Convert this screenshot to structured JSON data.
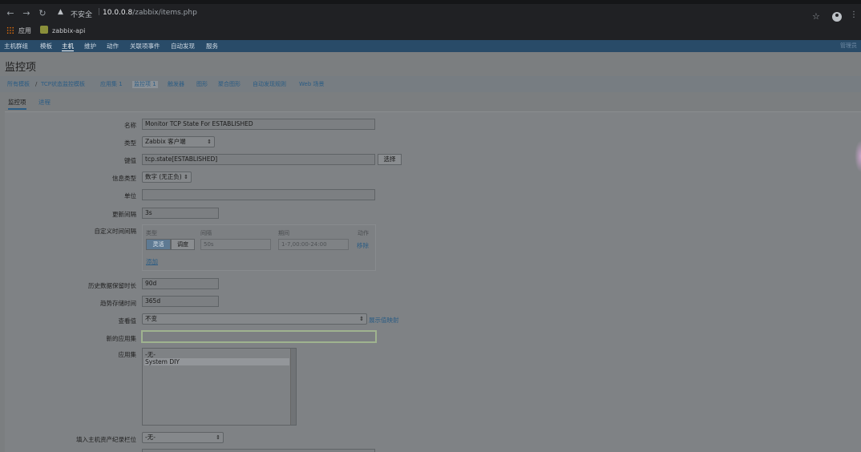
{
  "browser": {
    "insecure_label": "不安全",
    "url_host": "10.0.0.8",
    "url_path": "/zabbix/items.php",
    "bookmarks": [
      "应用",
      "zabbix-api"
    ]
  },
  "nav": {
    "items": [
      "主机群组",
      "模板",
      "主机",
      "维护",
      "动作",
      "关联项事件",
      "自动发现",
      "服务"
    ],
    "active": "主机",
    "right": "管理员"
  },
  "page": {
    "title": "监控项",
    "breadcrumb": [
      "所有模板",
      "TCP状态监控模板",
      "应用集 1",
      "监控项 1",
      "触发器",
      "图形",
      "聚合图形",
      "自动发现规则",
      "Web 场景"
    ],
    "tabs": [
      "监控项",
      "进程"
    ]
  },
  "form": {
    "name_label": "名称",
    "name_value": "Monitor TCP State For ESTABLISHED",
    "type_label": "类型",
    "type_value": "Zabbix 客户端",
    "key_label": "键值",
    "key_value": "tcp.state[ESTABLISHED]",
    "select_button": "选择",
    "info_type_label": "信息类型",
    "info_type_value": "数字 (无正负)",
    "unit_label": "单位",
    "unit_value": "",
    "update_interval_label": "更新间隔",
    "update_interval_value": "3s",
    "custom_intervals_label": "自定义时间间隔",
    "ci_headers": [
      "类型",
      "间隔",
      "期间",
      "动作"
    ],
    "ci_seg_flexible": "灵活",
    "ci_seg_scheduled": "调度",
    "ci_interval_placeholder": "50s",
    "ci_period_placeholder": "1-7,00:00-24:00",
    "ci_remove": "移除",
    "ci_add": "添加",
    "history_label": "历史数据保留时长",
    "history_value": "90d",
    "trends_label": "趋势存储时间",
    "trends_value": "365d",
    "show_value_label": "查看值",
    "show_value_value": "不变",
    "show_value_map_link": "展示值映射",
    "new_app_label": "新的应用集",
    "new_app_value": "",
    "apps_label": "应用集",
    "apps_options": [
      "-无-",
      "System DIY"
    ],
    "inventory_label": "填入主机资产纪录栏位",
    "inventory_value": "-无-"
  }
}
